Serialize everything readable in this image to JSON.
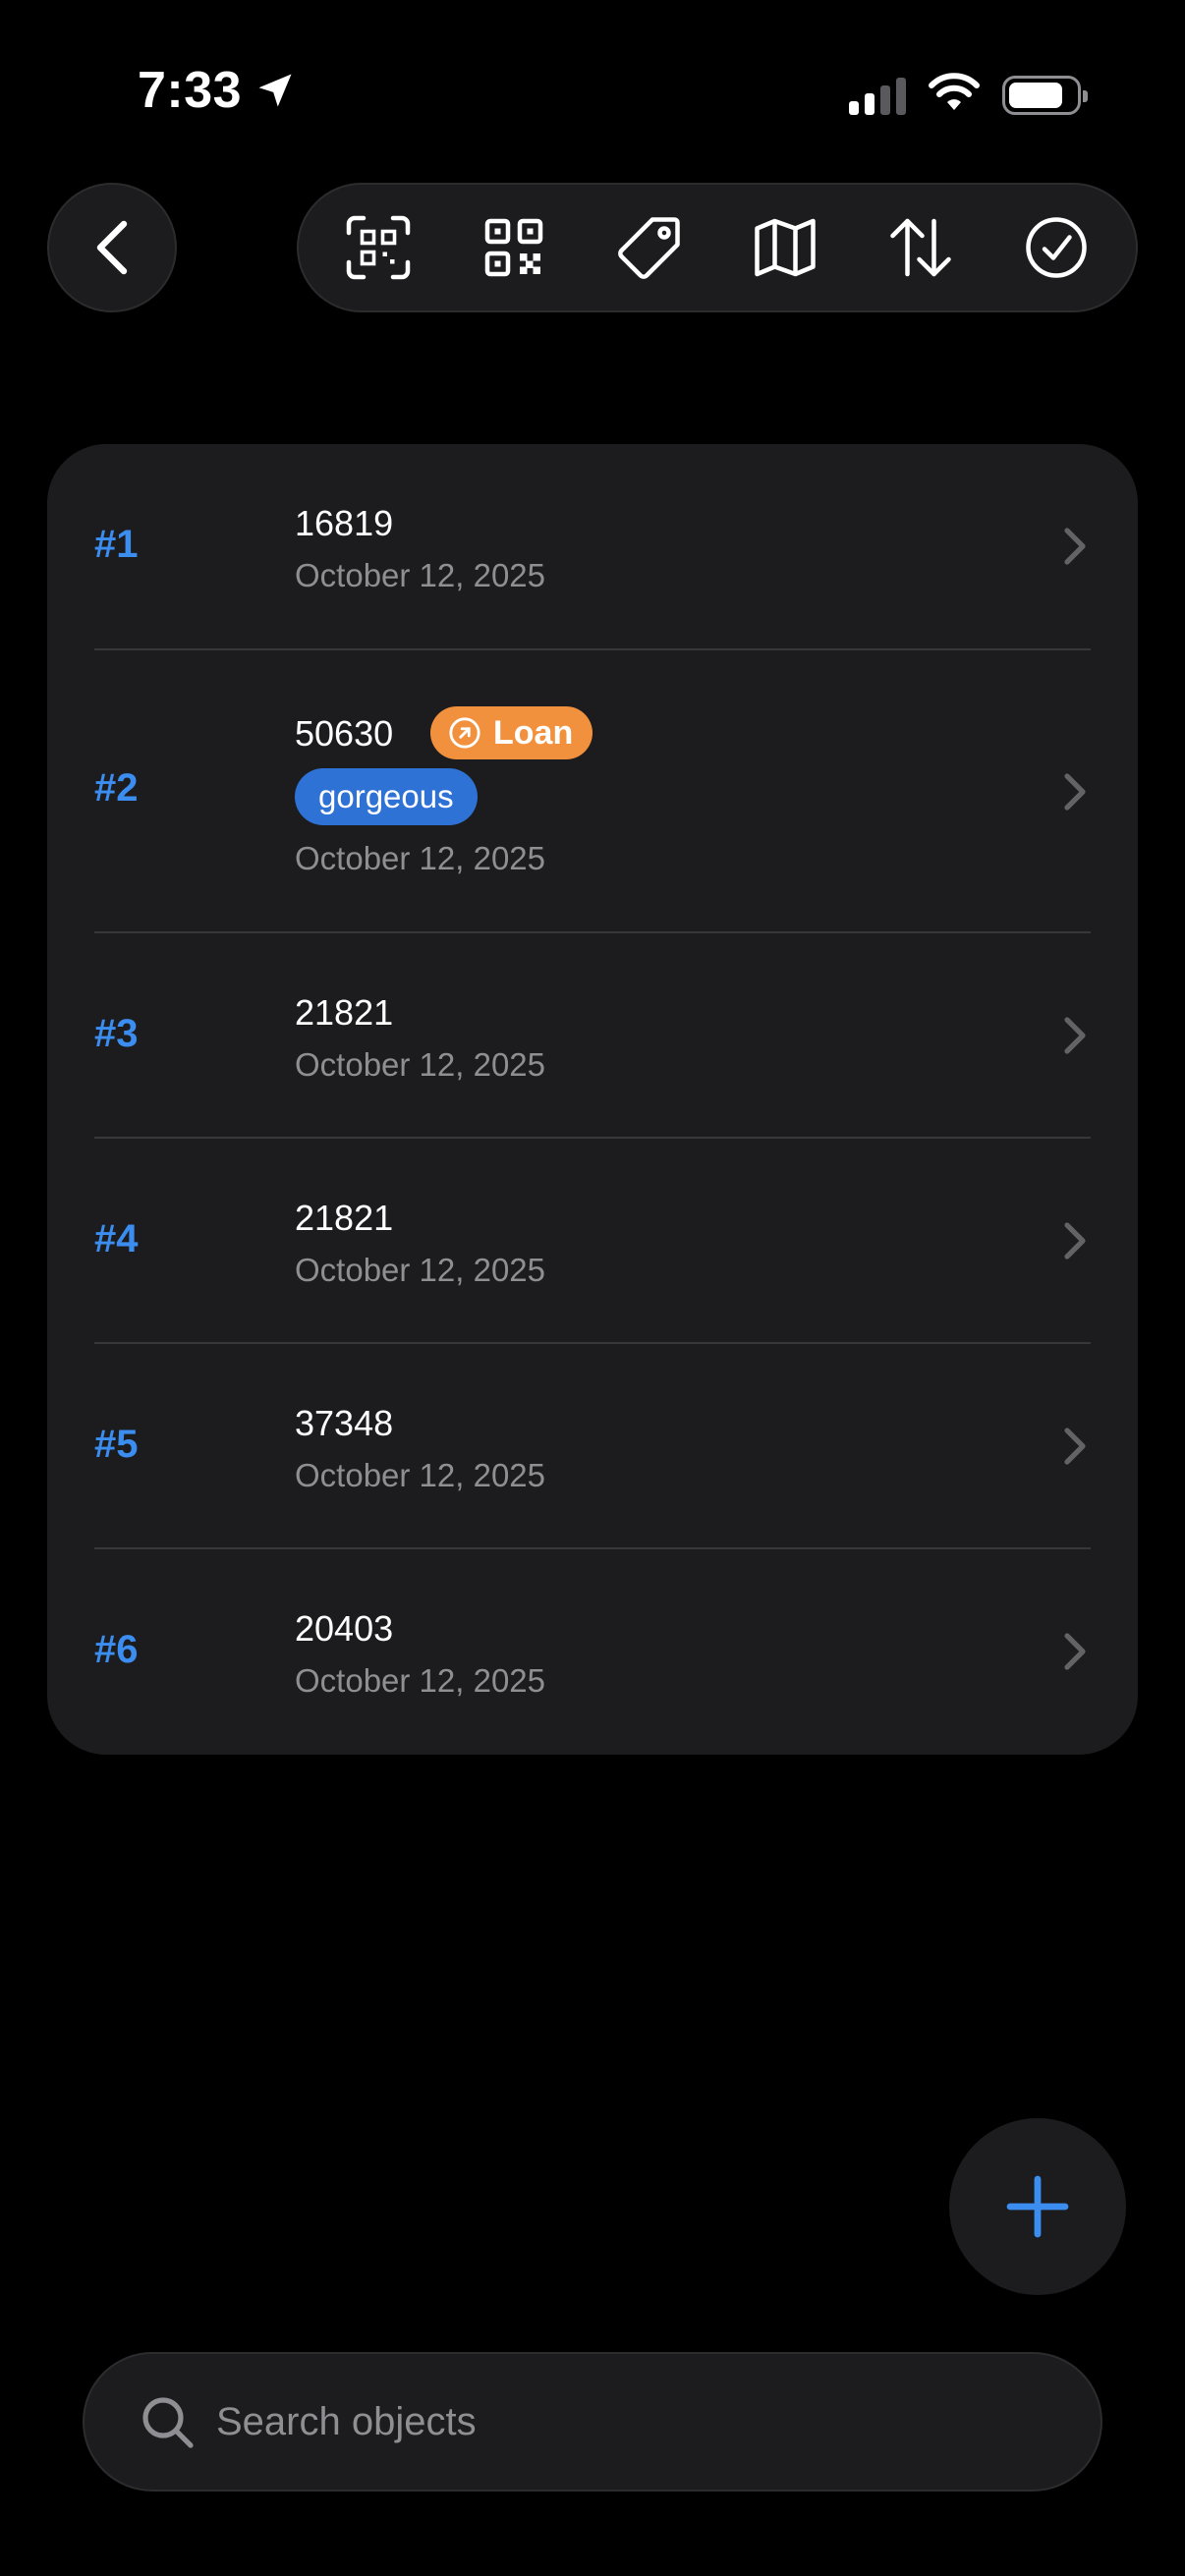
{
  "status_bar": {
    "time": "7:33"
  },
  "toolbar": {
    "tools": [
      {
        "icon": "qr-scan-icon"
      },
      {
        "icon": "qr-code-icon"
      },
      {
        "icon": "tag-icon"
      },
      {
        "icon": "map-icon"
      },
      {
        "icon": "sort-icon"
      },
      {
        "icon": "checkmark-circle-icon"
      }
    ]
  },
  "list": {
    "rows": [
      {
        "index": "#1",
        "title": "16819",
        "date": "October 12, 2025"
      },
      {
        "index": "#2",
        "title": "50630",
        "badge": "Loan",
        "tag": "gorgeous",
        "date": "October 12, 2025"
      },
      {
        "index": "#3",
        "title": "21821",
        "date": "October 12, 2025"
      },
      {
        "index": "#4",
        "title": "21821",
        "date": "October 12, 2025"
      },
      {
        "index": "#5",
        "title": "37348",
        "date": "October 12, 2025"
      },
      {
        "index": "#6",
        "title": "20403",
        "date": "October 12, 2025"
      }
    ]
  },
  "search": {
    "placeholder": "Search objects",
    "value": ""
  },
  "colors": {
    "accent": "#3b8df0",
    "loan_badge": "#f2913d",
    "tag_chip": "#2f72d6",
    "card_bg": "#1c1c1e"
  }
}
